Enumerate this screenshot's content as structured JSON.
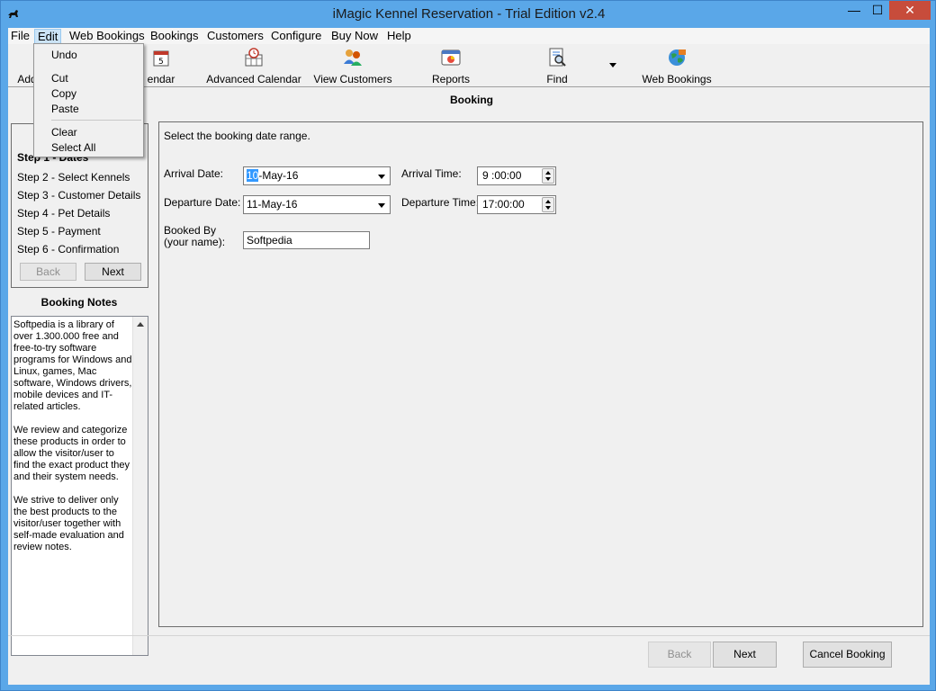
{
  "window": {
    "title": "iMagic Kennel Reservation - Trial Edition v2.4",
    "min_glyph": "—",
    "max_glyph": "☐",
    "close_glyph": "✕"
  },
  "menubar": {
    "items": [
      "File",
      "Edit",
      "Web Bookings",
      "Bookings",
      "Customers",
      "Configure",
      "Buy Now",
      "Help"
    ]
  },
  "edit_menu": {
    "undo": "Undo",
    "cut": "Cut",
    "copy": "Copy",
    "paste": "Paste",
    "clear": "Clear",
    "select_all": "Select All"
  },
  "toolbar": {
    "add_fragment": "Add",
    "calendar_fragment": "endar",
    "advanced_calendar": "Advanced Calendar",
    "view_customers": "View Customers",
    "reports": "Reports",
    "find": "Find",
    "web_bookings": "Web Bookings"
  },
  "heading": "Booking",
  "steps": {
    "current": "Step 1 - Dates",
    "items": [
      "Step 2 - Select Kennels",
      "Step 3 - Customer Details",
      "Step 4 - Pet Details",
      "Step 5 - Payment",
      "Step 6 - Confirmation"
    ],
    "back": "Back",
    "next": "Next"
  },
  "booking_notes": {
    "title": "Booking Notes",
    "paragraphs": [
      "Softpedia is a library of over 1.300.000 free and free-to-try software programs for Windows and Linux, games, Mac software, Windows drivers, mobile devices and IT-related articles.",
      "We review and categorize these products in order to allow the visitor/user to find the exact product they and their system needs.",
      "We strive to deliver only the best products to the visitor/user together with self-made evaluation and review notes."
    ]
  },
  "form": {
    "instruction": "Select the booking date range.",
    "arrival_date_label": "Arrival Date:",
    "arrival_date_day": "10",
    "arrival_date_rest": "-May-16",
    "arrival_time_label": "Arrival Time:",
    "arrival_time": "9 :00:00",
    "departure_date_label": "Departure Date:",
    "departure_date": "11-May-16",
    "departure_time_label": "Departure Time:",
    "departure_time": "17:00:00",
    "booked_by_label": "Booked By (your name):",
    "booked_by_value": "Softpedia"
  },
  "footer": {
    "back": "Back",
    "next": "Next",
    "cancel": "Cancel Booking"
  }
}
